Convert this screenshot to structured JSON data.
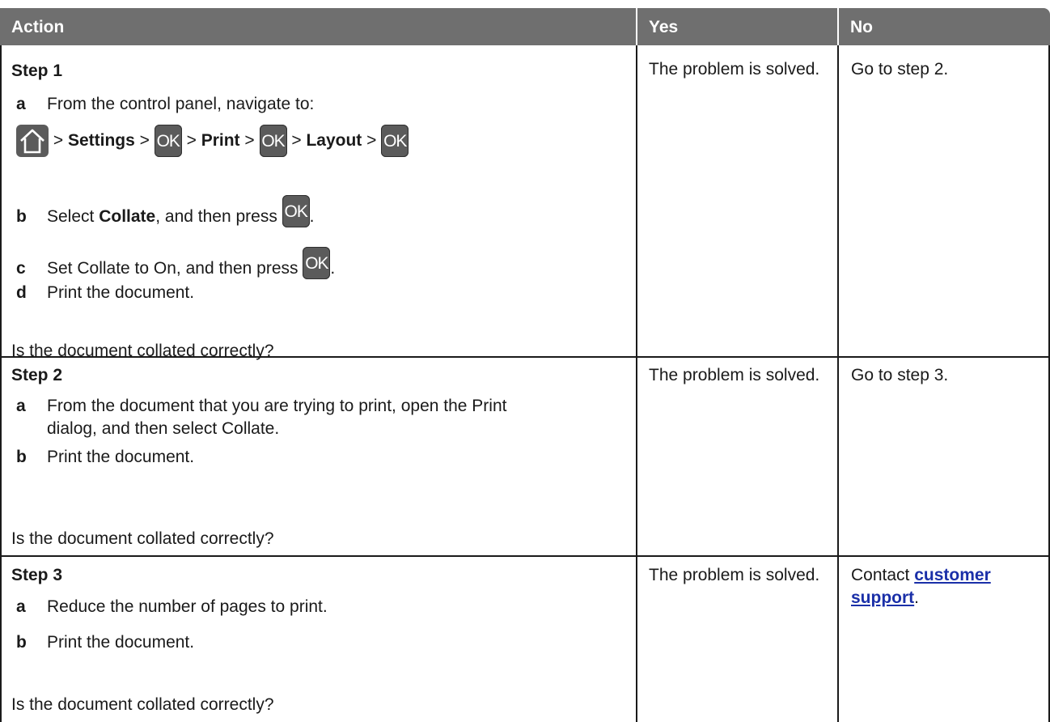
{
  "header": {
    "action": "Action",
    "yes": "Yes",
    "no": "No"
  },
  "rows": [
    {
      "step": "Step 1",
      "items": [
        {
          "letter": "a",
          "text": "From the control panel, navigate to:"
        },
        {
          "letter": "b",
          "pre": "Select ",
          "bold": "Collate",
          "post": ", and then press"
        },
        {
          "letter": "c",
          "pre": "Set Collate to On, and then press"
        },
        {
          "letter": "d",
          "pre": "Print the document."
        }
      ],
      "nav": {
        "sep": ">",
        "settings": "Settings",
        "print": "Print",
        "layout": "Layout"
      },
      "question": "Is the document collated correctly?",
      "yes": "The problem is solved.",
      "no": "Go to step 2."
    },
    {
      "step": "Step 2",
      "items": [
        {
          "letter": "a",
          "text_line1": "From the document that you are trying to print, open the Print",
          "text_line2": "dialog, and then select Collate."
        },
        {
          "letter": "b",
          "text": "Print the document."
        }
      ],
      "question": "Is the document collated correctly?",
      "yes": "The problem is solved.",
      "no": "Go to step 3."
    },
    {
      "step": "Step 3",
      "items": [
        {
          "letter": "a",
          "text": "Reduce the number of pages to print."
        },
        {
          "letter": "b",
          "text": "Print the document."
        }
      ],
      "question": "Is the document collated correctly?",
      "yes": "The problem is solved.",
      "no_pre": "Contact ",
      "no_link1": "customer",
      "no_link2": "support",
      "no_post": "."
    }
  ],
  "ok_label": "OK",
  "icons": {
    "home": "home-icon",
    "ok": "ok-button-icon"
  },
  "colors": {
    "header_bg": "#6f6f6f",
    "ok_bg": "#5b5b5b",
    "link": "#1a2fa8"
  }
}
